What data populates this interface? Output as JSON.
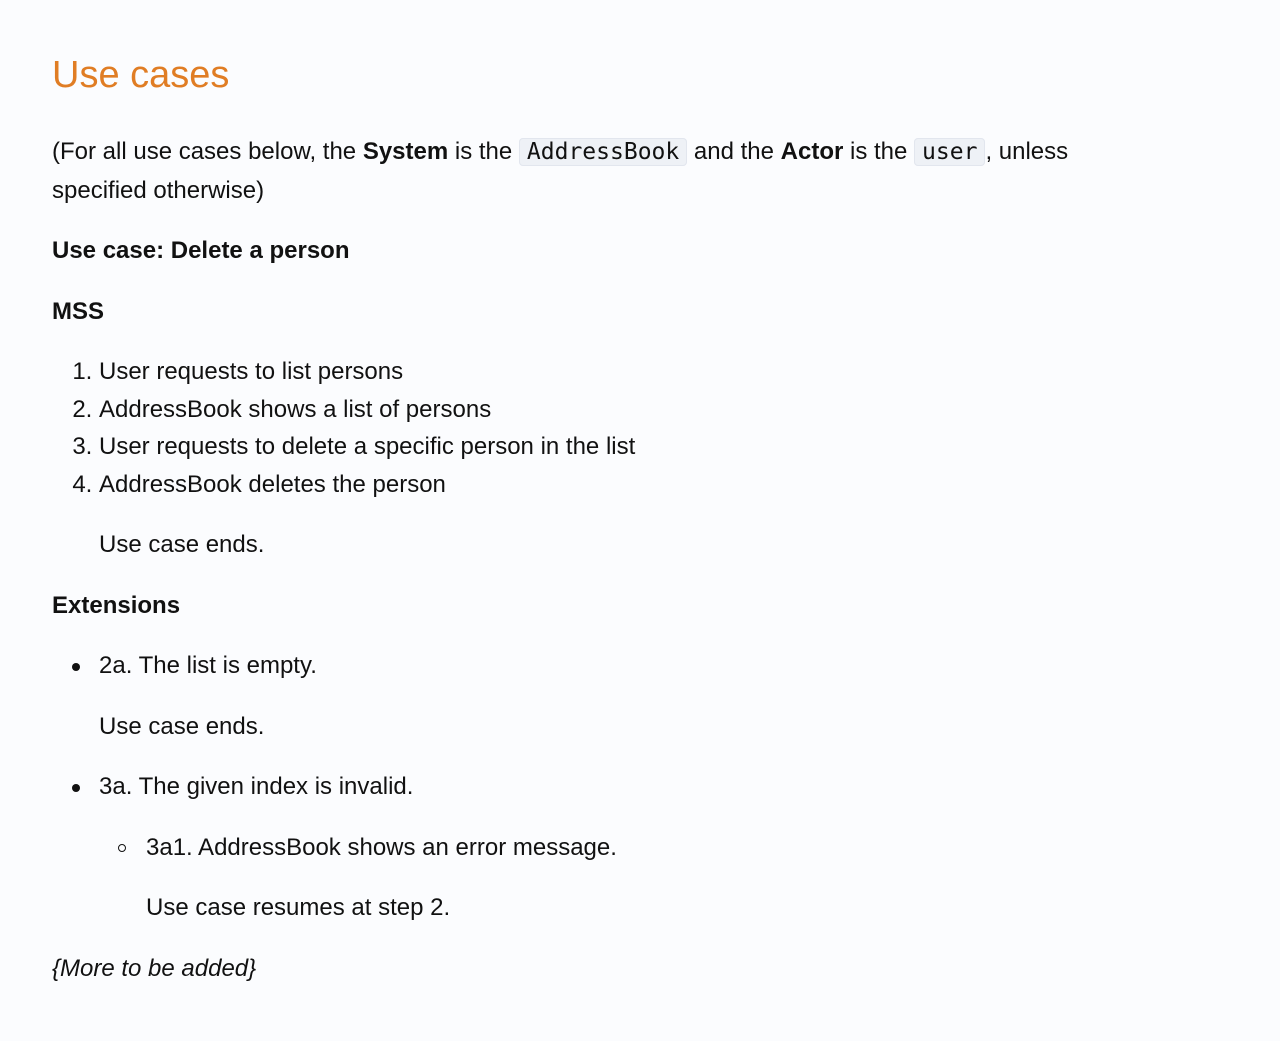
{
  "title": "Use cases",
  "intro": {
    "part1": "(For all use cases below, the ",
    "system_label": "System",
    "part2": " is the ",
    "system_code": "AddressBook",
    "part3": " and the ",
    "actor_label": "Actor",
    "part4": " is the ",
    "actor_code": "user",
    "part5": ", unless specified otherwise)"
  },
  "use_case_title": "Use case: Delete a person",
  "mss_heading": "MSS",
  "mss_steps": [
    "User requests to list persons",
    "AddressBook shows a list of persons",
    "User requests to delete a specific person in the list",
    "AddressBook deletes the person"
  ],
  "mss_end": "Use case ends.",
  "extensions_heading": "Extensions",
  "extensions": [
    {
      "label": "2a. The list is empty.",
      "note": "Use case ends."
    },
    {
      "label": "3a. The given index is invalid.",
      "sub": {
        "label": "3a1. AddressBook shows an error message.",
        "note": "Use case resumes at step 2."
      }
    }
  ],
  "more": "{More to be added}"
}
